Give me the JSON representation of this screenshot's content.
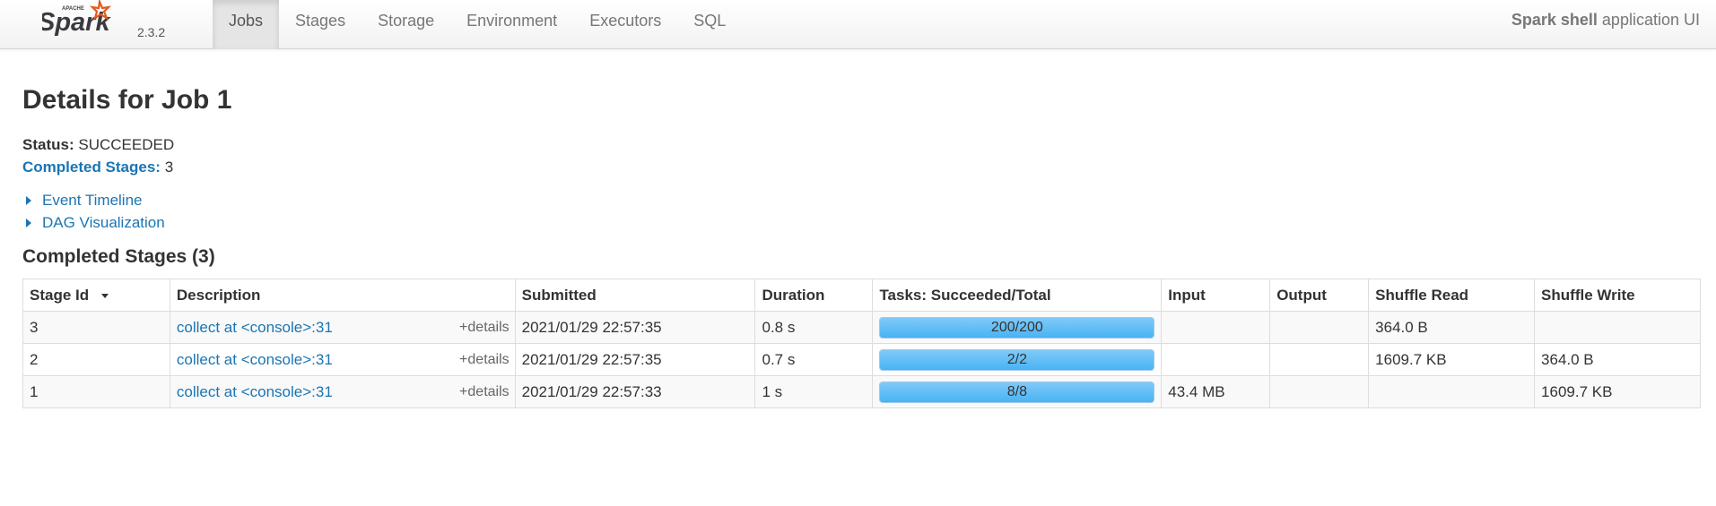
{
  "header": {
    "logo_text": "Spark",
    "logo_apache": "APACHE",
    "version": "2.3.2",
    "tabs": [
      {
        "label": "Jobs",
        "active": true
      },
      {
        "label": "Stages",
        "active": false
      },
      {
        "label": "Storage",
        "active": false
      },
      {
        "label": "Environment",
        "active": false
      },
      {
        "label": "Executors",
        "active": false
      },
      {
        "label": "SQL",
        "active": false
      }
    ],
    "app_name": "Spark shell",
    "app_suffix": "application UI"
  },
  "page": {
    "title": "Details for Job 1",
    "status_label": "Status:",
    "status_value": "SUCCEEDED",
    "completed_label": "Completed Stages:",
    "completed_value": "3",
    "event_timeline": "Event Timeline",
    "dag_visualization": "DAG Visualization",
    "section_title": "Completed Stages (3)"
  },
  "table": {
    "columns": [
      "Stage Id",
      "Description",
      "Submitted",
      "Duration",
      "Tasks: Succeeded/Total",
      "Input",
      "Output",
      "Shuffle Read",
      "Shuffle Write"
    ],
    "details_label": "+details",
    "rows": [
      {
        "stage_id": "3",
        "description": "collect at <console>:31",
        "submitted": "2021/01/29 22:57:35",
        "duration": "0.8 s",
        "tasks": "200/200",
        "progress": 1.0,
        "input": "",
        "output": "",
        "shuffle_read": "364.0 B",
        "shuffle_write": ""
      },
      {
        "stage_id": "2",
        "description": "collect at <console>:31",
        "submitted": "2021/01/29 22:57:35",
        "duration": "0.7 s",
        "tasks": "2/2",
        "progress": 1.0,
        "input": "",
        "output": "",
        "shuffle_read": "1609.7 KB",
        "shuffle_write": "364.0 B"
      },
      {
        "stage_id": "1",
        "description": "collect at <console>:31",
        "submitted": "2021/01/29 22:57:33",
        "duration": "1 s",
        "tasks": "8/8",
        "progress": 1.0,
        "input": "43.4 MB",
        "output": "",
        "shuffle_read": "",
        "shuffle_write": "1609.7 KB"
      }
    ]
  },
  "colors": {
    "link": "#1b75b3",
    "progress_fill": "#49b3f3",
    "logo_orange": "#e25a1c"
  }
}
